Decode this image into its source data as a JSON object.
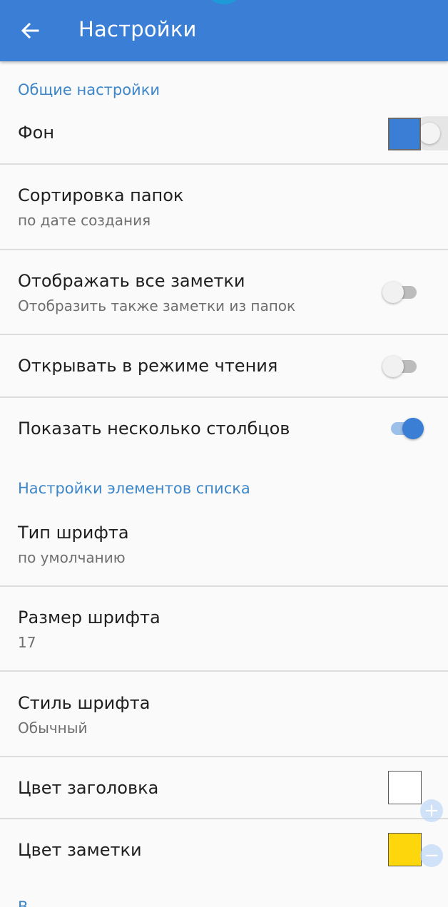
{
  "appbar": {
    "title": "Настройки",
    "back_icon": "arrow-left-icon"
  },
  "sections": {
    "general": "Общие настройки",
    "list_items": "Настройки элементов списка",
    "next_partial": "В"
  },
  "settings": {
    "background": {
      "title": "Фон",
      "accent": "#3a7fd5"
    },
    "folder_sort": {
      "title": "Сортировка папок",
      "summary": "по дате создания"
    },
    "show_all_notes": {
      "title": "Отображать все заметки",
      "summary": "Отобразить также заметки из папок",
      "enabled": false
    },
    "open_reading": {
      "title": "Открывать в режиме чтения",
      "enabled": false
    },
    "multi_columns": {
      "title": "Показать несколько столбцов",
      "enabled": true
    },
    "font_type": {
      "title": "Тип шрифта",
      "summary": "по умолчанию"
    },
    "font_size": {
      "title": "Размер шрифта",
      "summary": "17"
    },
    "font_style": {
      "title": "Стиль шрифта",
      "summary": "Обычный"
    },
    "header_color": {
      "title": "Цвет заголовка",
      "color": "#ffffff"
    },
    "note_color": {
      "title": "Цвет заметки",
      "color": "#fdd60b"
    }
  },
  "zoom": {
    "plus": "+",
    "minus": "−"
  }
}
